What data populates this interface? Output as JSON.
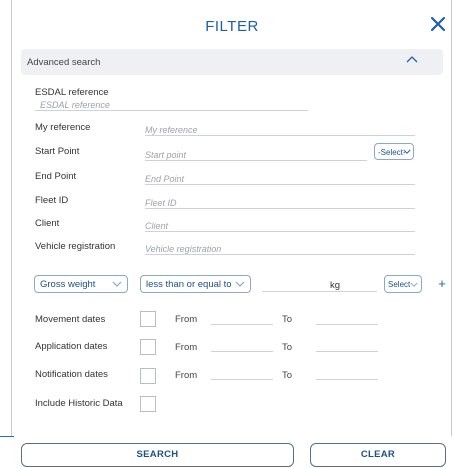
{
  "header": {
    "title": "FILTER"
  },
  "advanced_search": {
    "label": "Advanced search"
  },
  "fields": {
    "esdal_reference": {
      "label": "ESDAL reference",
      "placeholder": "ESDAL reference"
    },
    "my_reference": {
      "label": "My reference",
      "placeholder": "My reference"
    },
    "start_point": {
      "label": "Start Point",
      "placeholder": "Start point",
      "select_value": "-Select-"
    },
    "end_point": {
      "label": "End Point",
      "placeholder": "End Point"
    },
    "fleet_id": {
      "label": "Fleet ID",
      "placeholder": "Fleet ID"
    },
    "client": {
      "label": "Client",
      "placeholder": "Client"
    },
    "vehicle_registration": {
      "label": "Vehicle registration",
      "placeholder": "Vehicle registration"
    }
  },
  "weight_filter": {
    "attribute": "Gross weight",
    "operator": "less than or equal to",
    "value": "",
    "unit": "kg",
    "unit_select": "Select",
    "add_symbol": "+"
  },
  "date_filters": {
    "from_label": "From",
    "to_label": "To",
    "rows": [
      {
        "label": "Movement dates"
      },
      {
        "label": "Application dates"
      },
      {
        "label": "Notification dates"
      }
    ]
  },
  "historic": {
    "label": "Include Historic Data"
  },
  "buttons": {
    "search": "SEARCH",
    "clear": "CLEAR"
  },
  "colors": {
    "accent": "#1e5fa8",
    "button_text": "#1e4f8a",
    "advanced_bar": "#eef0f3"
  }
}
